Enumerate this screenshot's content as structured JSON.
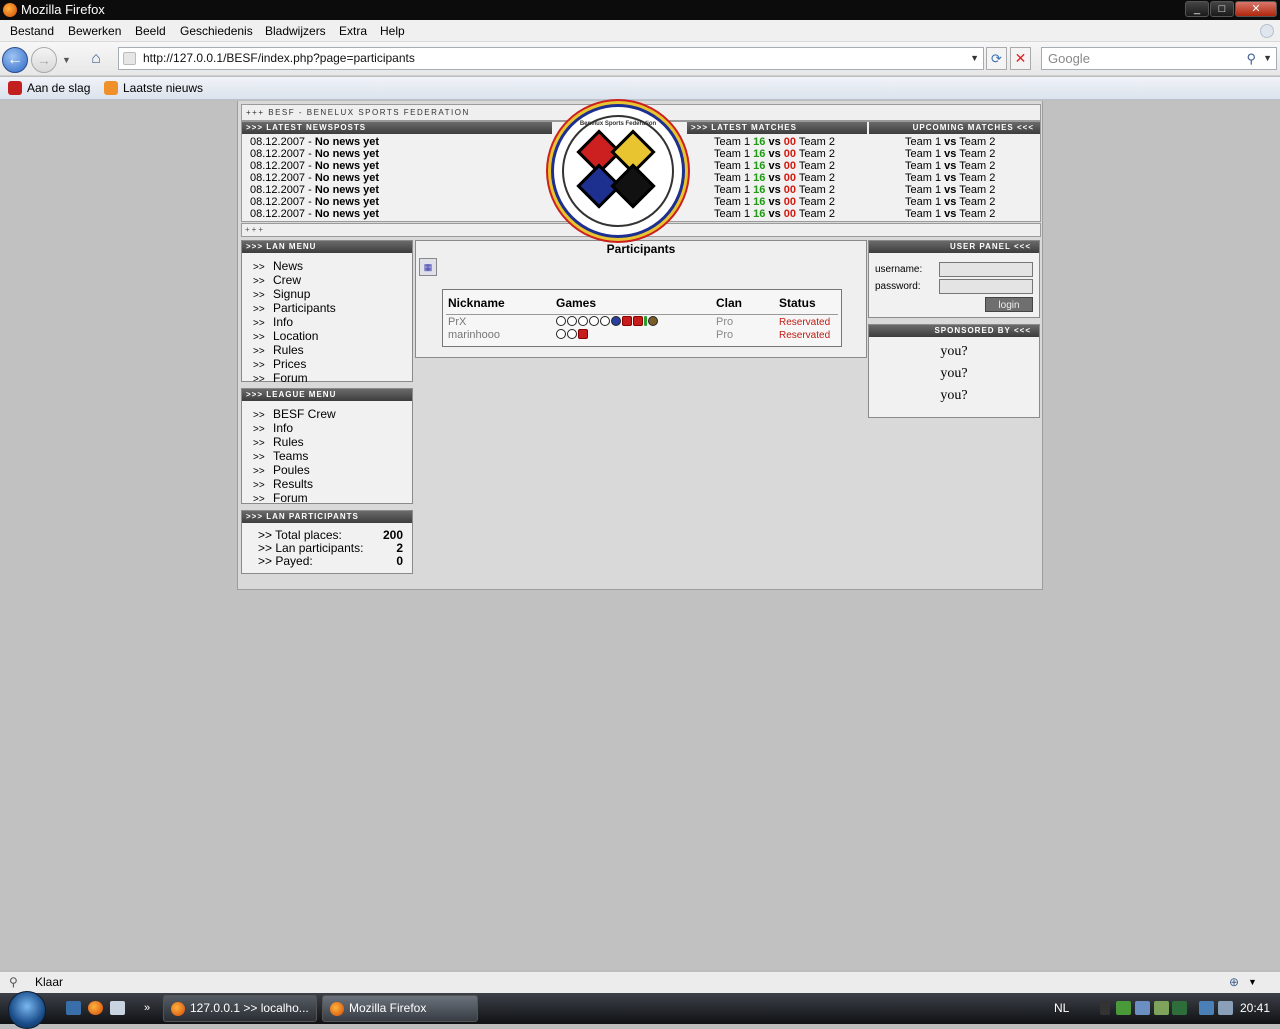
{
  "window": {
    "title": "Mozilla Firefox"
  },
  "menubar": [
    "Bestand",
    "Bewerken",
    "Beeld",
    "Geschiedenis",
    "Bladwijzers",
    "Extra",
    "Help"
  ],
  "navbar": {
    "url": "http://127.0.0.1/BESF/index.php?page=participants",
    "search_placeholder": "Google"
  },
  "bookmarks": [
    "Aan de slag",
    "Laatste nieuws"
  ],
  "site": {
    "top_title": "+++ BESF - BENELUX SPORTS FEDERATION",
    "plus_bar": "+++",
    "logo_text": "Benelux Sports Federation",
    "news_header": ">>> LATEST NEWSPOSTS",
    "news": [
      {
        "date": "08.12.2007",
        "text": "No news yet"
      },
      {
        "date": "08.12.2007",
        "text": "No news yet"
      },
      {
        "date": "08.12.2007",
        "text": "No news yet"
      },
      {
        "date": "08.12.2007",
        "text": "No news yet"
      },
      {
        "date": "08.12.2007",
        "text": "No news yet"
      },
      {
        "date": "08.12.2007",
        "text": "No news yet"
      },
      {
        "date": "08.12.2007",
        "text": "No news yet"
      }
    ],
    "latest_header": ">>> LATEST MATCHES",
    "latest": {
      "team1": "Team 1",
      "score1": "16",
      "vs": "vs",
      "score2": "00",
      "team2": "Team 2"
    },
    "upcoming_header": "UPCOMING MATCHES <<<",
    "upcoming": {
      "team1": "Team 1",
      "vs": "vs",
      "team2": "Team 2"
    },
    "lan_menu": {
      "header": ">>> LAN MENU",
      "items": [
        "News",
        "Crew",
        "Signup",
        "Participants",
        "Info",
        "Location",
        "Rules",
        "Prices",
        "Forum"
      ]
    },
    "league_menu": {
      "header": ">>> LEAGUE MENU",
      "items": [
        "BESF Crew",
        "Info",
        "Rules",
        "Teams",
        "Poules",
        "Results",
        "Forum"
      ]
    },
    "lan_participants": {
      "header": ">>> LAN PARTICIPANTS",
      "rows": [
        {
          "label": "Total places:",
          "value": "200"
        },
        {
          "label": "Lan participants:",
          "value": "2"
        },
        {
          "label": "Payed:",
          "value": "0"
        }
      ]
    },
    "participants": {
      "title": "Participants",
      "columns": [
        "Nickname",
        "Games",
        "Clan",
        "Status"
      ],
      "rows": [
        {
          "nickname": "PrX",
          "clan": "Pro",
          "status": "Reservated"
        },
        {
          "nickname": "marinhooo",
          "clan": "Pro",
          "status": "Reservated"
        }
      ]
    },
    "user_panel": {
      "header": "USER PANEL <<<",
      "username_label": "username:",
      "password_label": "password:",
      "login": "login"
    },
    "sponsored": {
      "header": "SPONSORED BY <<<",
      "items": [
        "you?",
        "you?",
        "you?"
      ]
    }
  },
  "statusbar": {
    "text": "Klaar"
  },
  "taskbar": {
    "buttons": [
      "127.0.0.1 >> localho...",
      "Mozilla Firefox"
    ],
    "lang": "NL",
    "time": "20:41"
  },
  "arrow_glyph": ">>",
  "colors": {
    "score_green": "#1d9a10",
    "score_red": "#d21b0e",
    "header_dark": "#4a4a4a"
  }
}
